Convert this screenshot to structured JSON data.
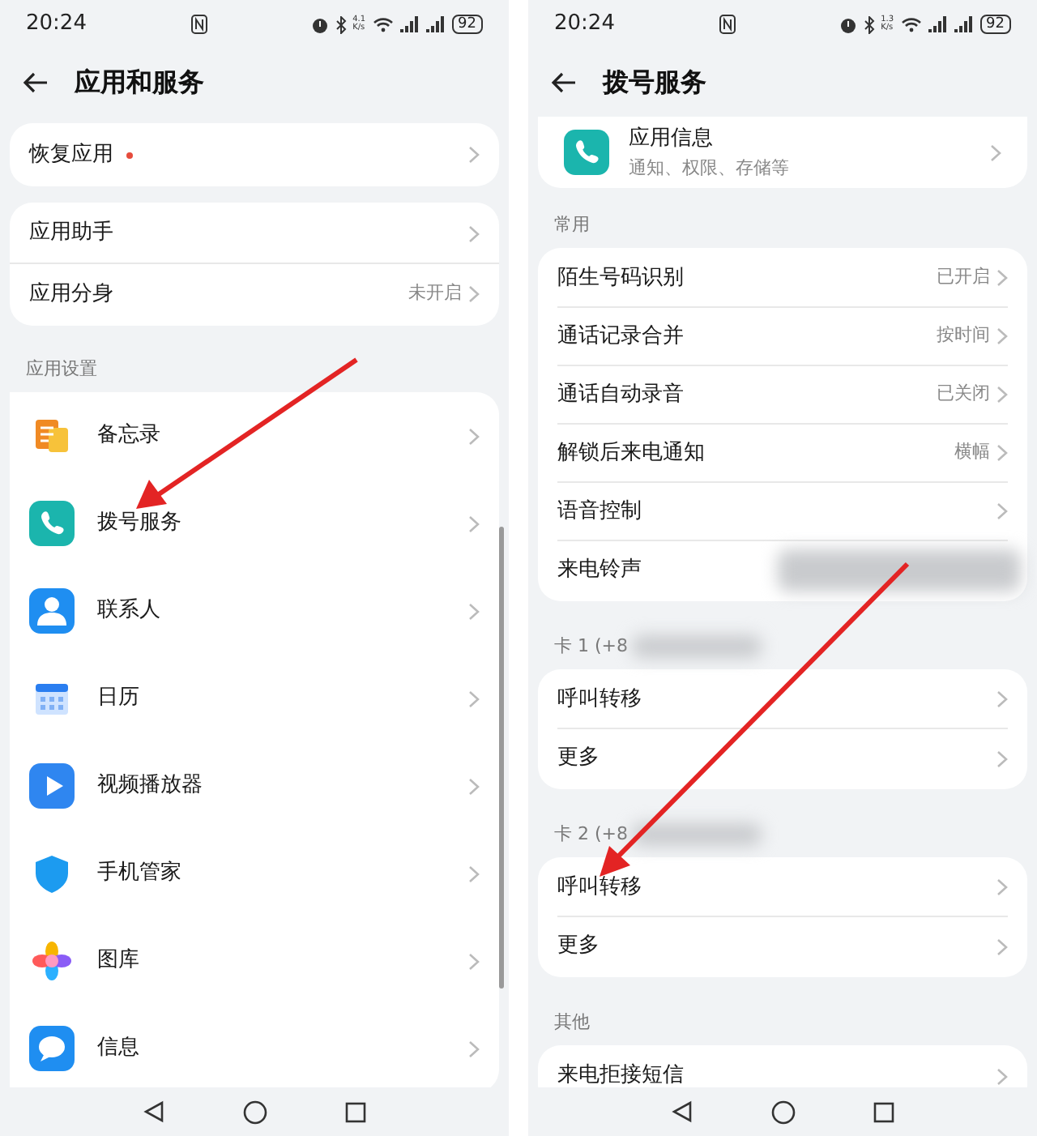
{
  "screens": [
    {
      "status_bar": {
        "time": "20:24",
        "speed_value": "4.1",
        "speed_unit": "K/s",
        "battery": "92"
      },
      "title": "应用和服务",
      "groups": [
        {
          "items": [
            {
              "label": "恢复应用",
              "new_badge": true
            }
          ]
        },
        {
          "items": [
            {
              "label": "应用助手"
            },
            {
              "label": "应用分身",
              "value": "未开启"
            }
          ]
        },
        {
          "label": "应用设置",
          "kind": "apps",
          "items": [
            {
              "label": "备忘录"
            },
            {
              "label": "拨号服务"
            },
            {
              "label": "联系人"
            },
            {
              "label": "日历"
            },
            {
              "label": "视频播放器"
            },
            {
              "label": "手机管家"
            },
            {
              "label": "图库"
            },
            {
              "label": "信息"
            }
          ]
        }
      ]
    },
    {
      "status_bar": {
        "time": "20:24",
        "speed_value": "1.3",
        "speed_unit": "K/s",
        "battery": "92"
      },
      "title": "拨号服务",
      "app_info": {
        "title": "应用信息",
        "subtitle": "通知、权限、存储等"
      },
      "groups": [
        {
          "label": "常用",
          "items": [
            {
              "label": "陌生号码识别",
              "value": "已开启"
            },
            {
              "label": "通话记录合并",
              "value": "按时间"
            },
            {
              "label": "通话自动录音",
              "value": "已关闭"
            },
            {
              "label": "解锁后来电通知",
              "value": "横幅"
            },
            {
              "label": "语音控制"
            },
            {
              "label": "来电铃声",
              "redacted": true
            }
          ]
        },
        {
          "label": "卡 1 (+8",
          "label_redacted": true,
          "items": [
            {
              "label": "呼叫转移"
            },
            {
              "label": "更多"
            }
          ]
        },
        {
          "label": "卡 2 (+8",
          "label_redacted": true,
          "items": [
            {
              "label": "呼叫转移"
            },
            {
              "label": "更多"
            }
          ]
        },
        {
          "label": "其他",
          "items": [
            {
              "label": "来电拒接短信"
            }
          ]
        }
      ]
    }
  ]
}
